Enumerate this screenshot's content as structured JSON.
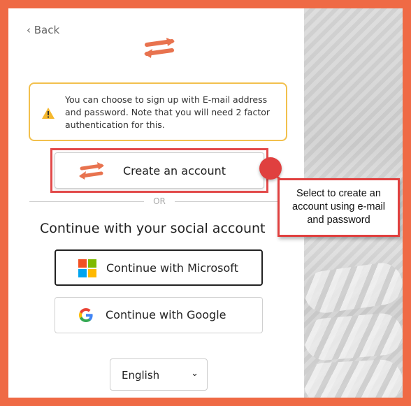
{
  "nav": {
    "back_label": "‹ Back"
  },
  "notice": {
    "text": "You can choose to sign up with E-mail address and password. Note that you will need 2 factor authentication for this.",
    "icon": "warning-icon",
    "border_color": "#f2c04d"
  },
  "create_account": {
    "label": "Create an account",
    "icon": "arrows-exchange-icon"
  },
  "divider": {
    "label": "OR"
  },
  "social": {
    "heading": "Continue with your social account",
    "microsoft_label": "Continue with Microsoft",
    "google_label": "Continue with Google"
  },
  "language": {
    "selected": "English"
  },
  "callout": {
    "text": "Select to create an account using e-mail and password",
    "accent_color": "#e0403f"
  },
  "colors": {
    "frame": "#ef6a45",
    "logo": "#e8734f",
    "highlight": "#e24a4a"
  }
}
